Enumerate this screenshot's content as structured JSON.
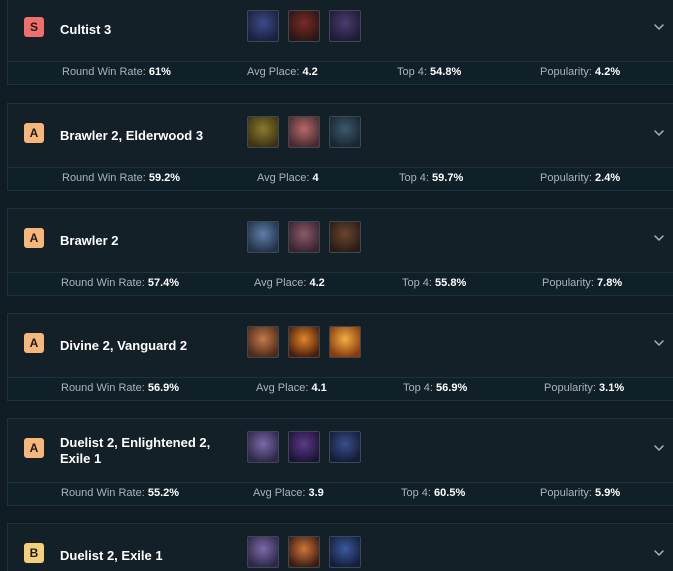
{
  "colors": {
    "tier_S": "#ef6f6c",
    "tier_A": "#f7b77a",
    "tier_B": "#f5d07a"
  },
  "stat_labels": {
    "win": "Round Win Rate:",
    "avg": "Avg Place:",
    "top4": "Top 4:",
    "pop": "Popularity:"
  },
  "comps": [
    {
      "tier": "S",
      "title": "Cultist 3",
      "champions": [
        "champion-portrait",
        "champion-portrait",
        "champion-portrait"
      ],
      "stats": {
        "win": "61%",
        "avg": "4.2",
        "top4": "54.8%",
        "pop": "4.2%"
      }
    },
    {
      "tier": "A",
      "title": "Brawler 2, Elderwood 3",
      "champions": [
        "champion-portrait",
        "champion-portrait",
        "champion-portrait"
      ],
      "stats": {
        "win": "59.2%",
        "avg": "4",
        "top4": "59.7%",
        "pop": "2.4%"
      }
    },
    {
      "tier": "A",
      "title": "Brawler 2",
      "champions": [
        "champion-portrait",
        "champion-portrait",
        "champion-portrait"
      ],
      "stats": {
        "win": "57.4%",
        "avg": "4.2",
        "top4": "55.8%",
        "pop": "7.8%"
      }
    },
    {
      "tier": "A",
      "title": "Divine 2, Vanguard 2",
      "champions": [
        "champion-portrait",
        "champion-portrait",
        "champion-portrait"
      ],
      "stats": {
        "win": "56.9%",
        "avg": "4.1",
        "top4": "56.9%",
        "pop": "3.1%"
      }
    },
    {
      "tier": "A",
      "title": "Duelist 2, Enlightened 2, Exile 1",
      "champions": [
        "champion-portrait",
        "champion-portrait",
        "champion-portrait"
      ],
      "stats": {
        "win": "55.2%",
        "avg": "3.9",
        "top4": "60.5%",
        "pop": "5.9%"
      }
    },
    {
      "tier": "B",
      "title": "Duelist 2, Exile 1",
      "champions": [
        "champion-portrait",
        "champion-portrait",
        "champion-portrait"
      ],
      "stats": null
    }
  ]
}
